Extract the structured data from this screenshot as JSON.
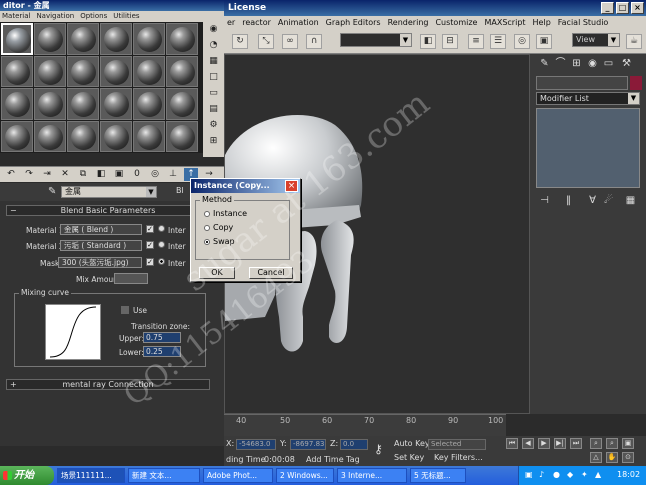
{
  "max_window": {
    "title": "License",
    "menu": [
      "er",
      "reactor",
      "Animation",
      "Graph Editors",
      "Rendering",
      "Customize",
      "MAXScript",
      "Help",
      "Facial Studio"
    ],
    "view_dropdown": "View",
    "modifier_list": "Modifier List"
  },
  "timeline": {
    "ticks": [
      "40",
      "50",
      "60",
      "70",
      "80",
      "90",
      "100"
    ]
  },
  "status": {
    "x_label": "X:",
    "x_value": "-54683.0",
    "y_label": "Y:",
    "y_value": "-8697.83",
    "z_label": "Z:",
    "z_value": "0.0",
    "auto_key": "Auto Key",
    "selected": "Selected",
    "set_key": "Set Key",
    "key_filters": "Key Filters...",
    "adding_time": "ding Time",
    "time_value": "0:00:08",
    "add_time_tag": "Add Time Tag"
  },
  "material_editor": {
    "title": "ditor - 金属",
    "menu": [
      "Material",
      "Navigation",
      "Options",
      "Utilities"
    ],
    "material_name": "金属",
    "type_button": "Bl",
    "rollout_blend": "Blend Basic Parameters",
    "material1_label": "Material 1:",
    "material1_value": "金属  ( Blend )",
    "material2_label": "Material 2:",
    "material2_value": "污垢  ( Standard )",
    "mask_label": "Mask:",
    "mask_value": "300 (头盔污垢.jpg)",
    "inter_label": "Inter",
    "mix_amount_label": "Mix Amount:",
    "mixing_curve_label": "Mixing curve",
    "use_label": "Use",
    "transition_zone_label": "Transition zone:",
    "upper_label": "Upper:",
    "upper_value": "0.75",
    "lower_label": "Lower:",
    "lower_value": "0.25",
    "rollout_mental": "mental ray Connection"
  },
  "dialog": {
    "title": "Instance (Copy...",
    "group_label": "Method",
    "options": [
      "Instance",
      "Copy",
      "Swap"
    ],
    "selected_option": "Swap",
    "ok_label": "OK",
    "cancel_label": "Cancel"
  },
  "taskbar": {
    "start_label": "开始",
    "tasks": [
      "场景111111...",
      "新建 文本...",
      "Adobe Phot...",
      "2 Windows...",
      "3 Interne...",
      "5 无标题..."
    ],
    "clock": "18:02"
  },
  "watermarks": {
    "email": "sugar  at  163.com",
    "qq": "QQ:115416493"
  },
  "colors": {
    "titlebar": "#0a246a",
    "viewport_bg": "#2f2f2f",
    "modifier_stack": "#52606f",
    "taskbar": "#245edc"
  }
}
